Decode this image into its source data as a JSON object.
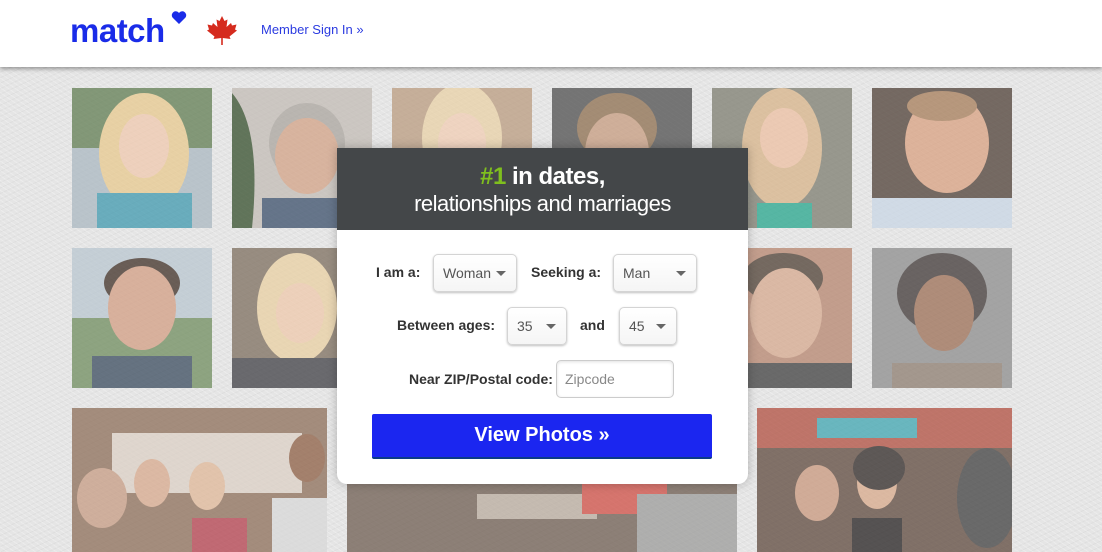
{
  "header": {
    "logo_text": "match",
    "logo_color": "#1a2ce8",
    "flag_icon": "canada-maple-leaf-icon",
    "flag_color": "#d52b1e",
    "signin_link": "Member Sign In »"
  },
  "card": {
    "headline_rank": "#1",
    "headline_rest": " in dates,",
    "subheadline": "relationships and marriages",
    "rank_color": "#7fbf1e",
    "header_bg": "#444749"
  },
  "form": {
    "i_am_label": "I am a:",
    "i_am_value": "Woman",
    "seeking_label": "Seeking a:",
    "seeking_value": "Man",
    "ages_label": "Between ages:",
    "age_min_value": "35",
    "and_label": "and",
    "age_max_value": "45",
    "zip_label": "Near ZIP/Postal code:",
    "zip_placeholder": "Zipcode",
    "zip_value": "",
    "submit_label": "View Photos »",
    "submit_color": "#1b26f0"
  },
  "photos": [
    {
      "name": "profile-photo-blonde-woman",
      "description": "smiling blonde woman outdoors"
    },
    {
      "name": "profile-photo-gray-haired-man",
      "description": "smiling gray-haired man with plant"
    },
    {
      "name": "profile-photo-blonde-woman-2",
      "description": "blonde woman"
    },
    {
      "name": "profile-photo-young-man",
      "description": "young man with short brown hair"
    },
    {
      "name": "profile-photo-blonde-woman-3",
      "description": "smiling blonde woman in teal top"
    },
    {
      "name": "profile-photo-man-light-shirt",
      "description": "smiling man in light blue shirt"
    },
    {
      "name": "profile-photo-dark-haired-man",
      "description": "smiling man with dark hair outdoors"
    },
    {
      "name": "profile-photo-blonde-woman-4",
      "description": "blonde woman smiling"
    },
    {
      "name": "profile-photo-bearded-man",
      "description": "man with dark hair and goatee"
    },
    {
      "name": "profile-photo-woman-short-hair",
      "description": "smiling woman with short dark hair"
    },
    {
      "name": "group-photo-toast",
      "description": "friends toasting drinks at bar"
    },
    {
      "name": "group-photo-bar",
      "description": "people at a bar"
    },
    {
      "name": "group-photo-party",
      "description": "couple at a party"
    }
  ]
}
